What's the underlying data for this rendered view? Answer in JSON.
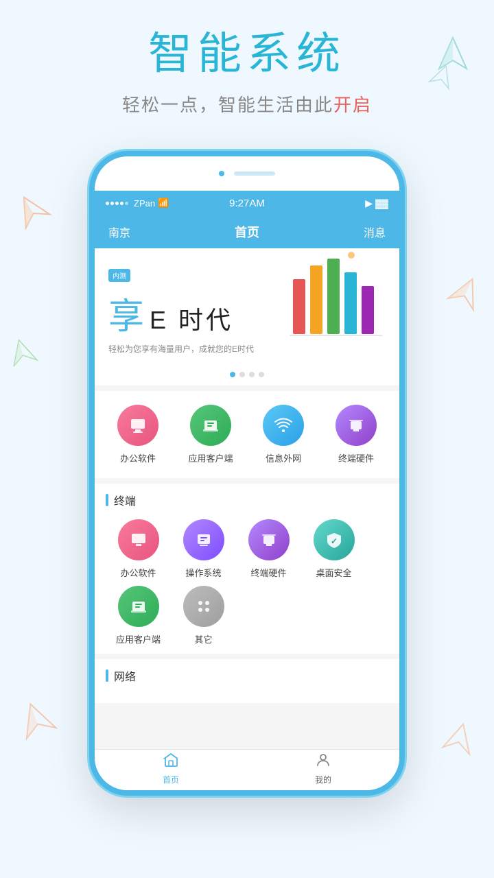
{
  "page": {
    "background_color": "#f0f8ff"
  },
  "top_section": {
    "main_title": "智能系统",
    "sub_title_part1": "轻松一点，智能生活由此",
    "sub_title_part2": "开启"
  },
  "status_bar": {
    "carrier": "ZPan",
    "wifi": "📶",
    "time": "9:27AM",
    "signal_icon": "▶",
    "battery": "▓"
  },
  "nav_bar": {
    "left": "南京",
    "center": "首页",
    "right": "消息"
  },
  "banner": {
    "badge": "内测",
    "title_prefix": "享",
    "title_main": "E 时代",
    "subtitle": "轻松为您享有海量用户，成就您的E时代",
    "dots": [
      true,
      false,
      false,
      false
    ]
  },
  "quick_icons": [
    {
      "label": "办公软件",
      "color": "ic-pink",
      "icon": "🖥"
    },
    {
      "label": "应用客户端",
      "color": "ic-green",
      "icon": "🖨"
    },
    {
      "label": "信息外网",
      "color": "ic-blue",
      "icon": "📡"
    },
    {
      "label": "终端硬件",
      "color": "ic-purple",
      "icon": "🖥"
    }
  ],
  "section_terminal": {
    "title": "终端",
    "icons": [
      {
        "label": "办公软件",
        "color": "ic-pink",
        "icon": "🖥"
      },
      {
        "label": "操作系统",
        "color": "ic-purple",
        "icon": "🖥"
      },
      {
        "label": "终端硬件",
        "color": "ic-purple",
        "icon": "🖥"
      },
      {
        "label": "桌面安全",
        "color": "ic-teal",
        "icon": "🛡"
      },
      {
        "label": "应用客户端",
        "color": "ic-green",
        "icon": "🖨"
      },
      {
        "label": "其它",
        "color": "ic-gray",
        "icon": "⋯"
      }
    ]
  },
  "section_network": {
    "title": "网络"
  },
  "tab_bar": {
    "items": [
      {
        "label": "首页",
        "active": true
      },
      {
        "label": "我的",
        "active": false
      }
    ]
  }
}
